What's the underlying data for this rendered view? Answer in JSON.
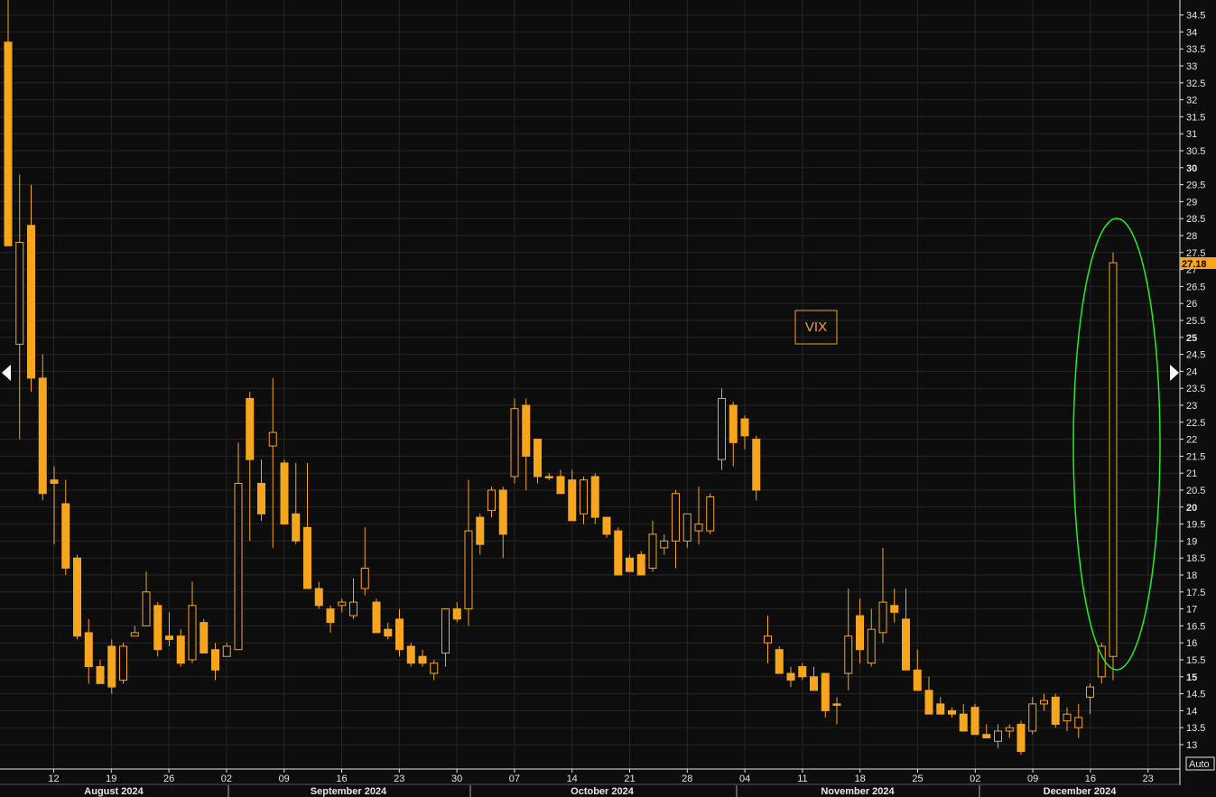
{
  "chart_data": {
    "type": "candlestick",
    "ylim": [
      12.6,
      35
    ],
    "grid": true,
    "colors": {
      "candle": "#f7a51c",
      "background": "#0d0d0d",
      "grid": "#262626",
      "highlight": "#22ee22",
      "last_tag": "#f7a51c"
    },
    "annotation": "VIX",
    "last_value": "27.18",
    "auto_label": "Auto",
    "y_ticks": [
      "13",
      "13.5",
      "14",
      "14.5",
      "15",
      "15.5",
      "16",
      "16.5",
      "17",
      "17.5",
      "18",
      "18.5",
      "19",
      "19.5",
      "20",
      "20.5",
      "21",
      "21.5",
      "22",
      "22.5",
      "23",
      "23.5",
      "24",
      "24.5",
      "25",
      "25.5",
      "26",
      "26.5",
      "27",
      "27.5",
      "28",
      "28.5",
      "29",
      "29.5",
      "30",
      "30.5",
      "31",
      "31.5",
      "32",
      "32.5",
      "33",
      "33.5",
      "34",
      "34.5"
    ],
    "x_tick_labels": [
      "12",
      "19",
      "26",
      "02",
      "09",
      "16",
      "23",
      "30",
      "07",
      "14",
      "21",
      "28",
      "04",
      "11",
      "18",
      "25",
      "02",
      "09",
      "16",
      "23"
    ],
    "months": [
      "August 2024",
      "September 2024",
      "October 2024",
      "November 2024",
      "December 2024"
    ],
    "candles": [
      {
        "open": 33.7,
        "high": 36.0,
        "low": 27.7,
        "close": 27.7
      },
      {
        "open": 24.8,
        "high": 29.8,
        "low": 22.0,
        "close": 27.8
      },
      {
        "open": 28.3,
        "high": 29.5,
        "low": 23.4,
        "close": 23.8
      },
      {
        "open": 23.8,
        "high": 24.5,
        "low": 20.2,
        "close": 20.4
      },
      {
        "open": 20.8,
        "high": 21.2,
        "low": 18.9,
        "close": 20.7
      },
      {
        "open": 20.1,
        "high": 20.8,
        "low": 18.0,
        "close": 18.2
      },
      {
        "open": 18.5,
        "high": 18.6,
        "low": 16.1,
        "close": 16.2
      },
      {
        "open": 16.3,
        "high": 16.7,
        "low": 14.8,
        "close": 15.3
      },
      {
        "open": 15.3,
        "high": 15.5,
        "low": 14.8,
        "close": 14.8
      },
      {
        "open": 15.9,
        "high": 16.1,
        "low": 14.5,
        "close": 14.7
      },
      {
        "open": 14.9,
        "high": 16.0,
        "low": 14.8,
        "close": 15.9
      },
      {
        "open": 16.2,
        "high": 16.5,
        "low": 16.2,
        "close": 16.3
      },
      {
        "open": 16.5,
        "high": 18.1,
        "low": 16.5,
        "close": 17.5
      },
      {
        "open": 17.1,
        "high": 17.2,
        "low": 15.6,
        "close": 15.8
      },
      {
        "open": 16.2,
        "high": 16.9,
        "low": 15.9,
        "close": 16.1
      },
      {
        "open": 16.2,
        "high": 16.4,
        "low": 15.3,
        "close": 15.4
      },
      {
        "open": 15.5,
        "high": 17.8,
        "low": 15.4,
        "close": 17.1
      },
      {
        "open": 16.6,
        "high": 16.7,
        "low": 15.7,
        "close": 15.7
      },
      {
        "open": 15.8,
        "high": 16.0,
        "low": 14.9,
        "close": 15.2
      },
      {
        "open": 15.6,
        "high": 16.0,
        "low": 15.6,
        "close": 15.9
      },
      {
        "open": 15.8,
        "high": 21.9,
        "low": 15.8,
        "close": 20.7
      },
      {
        "open": 23.2,
        "high": 23.4,
        "low": 19.0,
        "close": 21.4
      },
      {
        "open": 20.7,
        "high": 21.4,
        "low": 19.6,
        "close": 19.8
      },
      {
        "open": 21.8,
        "high": 23.8,
        "low": 18.8,
        "close": 22.2
      },
      {
        "open": 21.3,
        "high": 21.4,
        "low": 19.5,
        "close": 19.5
      },
      {
        "open": 19.8,
        "high": 21.3,
        "low": 18.9,
        "close": 19.0
      },
      {
        "open": 19.4,
        "high": 21.3,
        "low": 17.8,
        "close": 17.6
      },
      {
        "open": 17.6,
        "high": 17.8,
        "low": 17.0,
        "close": 17.1
      },
      {
        "open": 17.0,
        "high": 17.1,
        "low": 16.3,
        "close": 16.6
      },
      {
        "open": 17.1,
        "high": 17.3,
        "low": 16.9,
        "close": 17.2
      },
      {
        "open": 16.8,
        "high": 17.9,
        "low": 16.7,
        "close": 17.2
      },
      {
        "open": 17.6,
        "high": 19.4,
        "low": 17.4,
        "close": 18.2
      },
      {
        "open": 17.2,
        "high": 17.3,
        "low": 16.3,
        "close": 16.3
      },
      {
        "open": 16.4,
        "high": 16.6,
        "low": 16.1,
        "close": 16.2
      },
      {
        "open": 16.7,
        "high": 17.0,
        "low": 15.6,
        "close": 15.8
      },
      {
        "open": 15.9,
        "high": 16.0,
        "low": 15.3,
        "close": 15.4
      },
      {
        "open": 15.6,
        "high": 15.8,
        "low": 15.3,
        "close": 15.4
      },
      {
        "open": 15.1,
        "high": 15.5,
        "low": 14.9,
        "close": 15.4
      },
      {
        "open": 15.7,
        "high": 17.0,
        "low": 15.3,
        "close": 17.0
      },
      {
        "open": 17.0,
        "high": 17.2,
        "low": 16.6,
        "close": 16.7
      },
      {
        "open": 17.0,
        "high": 20.8,
        "low": 16.5,
        "close": 19.3
      },
      {
        "open": 19.7,
        "high": 19.8,
        "low": 18.6,
        "close": 18.9
      },
      {
        "open": 19.9,
        "high": 20.6,
        "low": 19.7,
        "close": 20.5
      },
      {
        "open": 20.5,
        "high": 20.6,
        "low": 18.5,
        "close": 19.2
      },
      {
        "open": 20.9,
        "high": 23.2,
        "low": 20.7,
        "close": 22.9
      },
      {
        "open": 23.0,
        "high": 23.2,
        "low": 20.5,
        "close": 21.5
      },
      {
        "open": 22.0,
        "high": 22.0,
        "low": 20.7,
        "close": 20.9
      },
      {
        "open": 20.9,
        "high": 21.0,
        "low": 20.8,
        "close": 20.9
      },
      {
        "open": 20.9,
        "high": 21.1,
        "low": 20.4,
        "close": 20.4
      },
      {
        "open": 20.8,
        "high": 21.1,
        "low": 19.6,
        "close": 19.6
      },
      {
        "open": 19.8,
        "high": 20.9,
        "low": 19.5,
        "close": 20.8
      },
      {
        "open": 20.9,
        "high": 21.0,
        "low": 19.5,
        "close": 19.7
      },
      {
        "open": 19.7,
        "high": 19.7,
        "low": 19.1,
        "close": 19.2
      },
      {
        "open": 19.3,
        "high": 19.4,
        "low": 18.0,
        "close": 18.0
      },
      {
        "open": 18.5,
        "high": 18.6,
        "low": 18.1,
        "close": 18.1
      },
      {
        "open": 18.6,
        "high": 18.7,
        "low": 18.0,
        "close": 18.0
      },
      {
        "open": 18.2,
        "high": 19.6,
        "low": 18.1,
        "close": 19.2
      },
      {
        "open": 18.8,
        "high": 19.2,
        "low": 18.6,
        "close": 19.0
      },
      {
        "open": 19.0,
        "high": 20.5,
        "low": 18.2,
        "close": 20.4
      },
      {
        "open": 19.0,
        "high": 19.7,
        "low": 18.8,
        "close": 19.8
      },
      {
        "open": 19.3,
        "high": 20.6,
        "low": 18.9,
        "close": 19.5
      },
      {
        "open": 19.3,
        "high": 20.4,
        "low": 19.2,
        "close": 20.3
      },
      {
        "open": 21.4,
        "high": 23.5,
        "low": 21.1,
        "close": 23.2
      },
      {
        "open": 23.0,
        "high": 23.1,
        "low": 21.2,
        "close": 21.9
      },
      {
        "open": 22.6,
        "high": 22.7,
        "low": 21.7,
        "close": 22.1
      },
      {
        "open": 22.0,
        "high": 22.1,
        "low": 20.2,
        "close": 20.5
      },
      {
        "open": 16.0,
        "high": 16.8,
        "low": 15.4,
        "close": 16.2
      },
      {
        "open": 15.8,
        "high": 15.9,
        "low": 15.1,
        "close": 15.1
      },
      {
        "open": 15.1,
        "high": 15.3,
        "low": 14.7,
        "close": 14.9
      },
      {
        "open": 15.3,
        "high": 15.4,
        "low": 14.9,
        "close": 15.0
      },
      {
        "open": 15.0,
        "high": 15.3,
        "low": 14.7,
        "close": 14.6
      },
      {
        "open": 15.1,
        "high": 15.1,
        "low": 13.8,
        "close": 14.0
      },
      {
        "open": 14.2,
        "high": 14.4,
        "low": 13.6,
        "close": 14.2
      },
      {
        "open": 15.1,
        "high": 17.6,
        "low": 14.6,
        "close": 16.2
      },
      {
        "open": 16.8,
        "high": 17.3,
        "low": 15.4,
        "close": 15.8
      },
      {
        "open": 15.4,
        "high": 17.0,
        "low": 15.3,
        "close": 16.4
      },
      {
        "open": 16.3,
        "high": 18.8,
        "low": 16.0,
        "close": 17.2
      },
      {
        "open": 17.1,
        "high": 17.6,
        "low": 16.6,
        "close": 16.9
      },
      {
        "open": 16.7,
        "high": 17.6,
        "low": 15.2,
        "close": 15.2
      },
      {
        "open": 15.2,
        "high": 15.8,
        "low": 14.6,
        "close": 14.6
      },
      {
        "open": 14.6,
        "high": 15.0,
        "low": 13.9,
        "close": 13.9
      },
      {
        "open": 14.2,
        "high": 14.4,
        "low": 13.9,
        "close": 13.9
      },
      {
        "open": 14.0,
        "high": 14.1,
        "low": 13.8,
        "close": 13.9
      },
      {
        "open": 13.9,
        "high": 14.2,
        "low": 13.4,
        "close": 13.4
      },
      {
        "open": 14.1,
        "high": 14.2,
        "low": 13.4,
        "close": 13.3
      },
      {
        "open": 13.3,
        "high": 13.6,
        "low": 13.2,
        "close": 13.2
      },
      {
        "open": 13.1,
        "high": 13.6,
        "low": 12.9,
        "close": 13.4
      },
      {
        "open": 13.4,
        "high": 13.6,
        "low": 13.2,
        "close": 13.5
      },
      {
        "open": 13.6,
        "high": 13.7,
        "low": 12.7,
        "close": 12.8
      },
      {
        "open": 13.4,
        "high": 14.4,
        "low": 13.3,
        "close": 14.2
      },
      {
        "open": 14.2,
        "high": 14.5,
        "low": 14.0,
        "close": 14.3
      },
      {
        "open": 14.4,
        "high": 14.5,
        "low": 13.5,
        "close": 13.6
      },
      {
        "open": 13.7,
        "high": 14.1,
        "low": 13.4,
        "close": 13.9
      },
      {
        "open": 13.5,
        "high": 14.2,
        "low": 13.2,
        "close": 13.8
      },
      {
        "open": 14.4,
        "high": 14.8,
        "low": 13.9,
        "close": 14.7
      },
      {
        "open": 15.0,
        "high": 16.0,
        "low": 14.8,
        "close": 15.9
      },
      {
        "open": 15.6,
        "high": 27.5,
        "low": 14.9,
        "close": 27.2
      }
    ]
  }
}
